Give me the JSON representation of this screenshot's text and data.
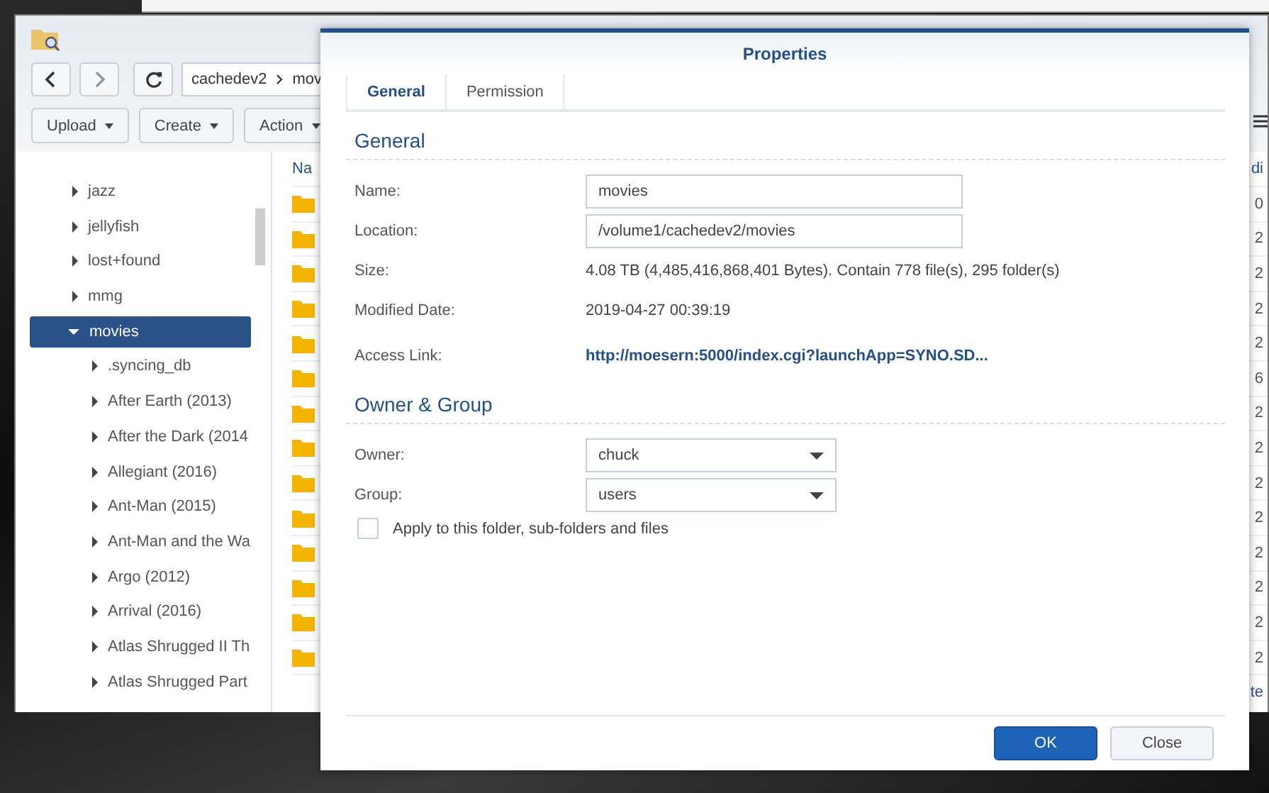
{
  "file_station": {
    "breadcrumb": [
      "cachedev2",
      "mov"
    ],
    "toolbar": [
      "Upload",
      "Create",
      "Action"
    ],
    "tree": [
      {
        "label": "jazz",
        "expanded": false,
        "selected": false
      },
      {
        "label": "jellyfish",
        "expanded": false,
        "selected": false
      },
      {
        "label": "lost+found",
        "expanded": false,
        "selected": false
      },
      {
        "label": "mmg",
        "expanded": false,
        "selected": false
      },
      {
        "label": "movies",
        "expanded": true,
        "selected": true,
        "children": [
          {
            "label": ".syncing_db",
            "expanded": false,
            "selected": false
          },
          {
            "label": "After Earth (2013)",
            "expanded": false,
            "selected": false
          },
          {
            "label": "After the Dark (2014",
            "expanded": false,
            "selected": false
          },
          {
            "label": "Allegiant (2016)",
            "expanded": false,
            "selected": false
          },
          {
            "label": "Ant-Man (2015)",
            "expanded": false,
            "selected": false
          },
          {
            "label": "Ant-Man and the Wa",
            "expanded": false,
            "selected": false
          },
          {
            "label": "Argo (2012)",
            "expanded": false,
            "selected": false
          },
          {
            "label": "Arrival (2016)",
            "expanded": false,
            "selected": false
          },
          {
            "label": "Atlas Shrugged II Th",
            "expanded": false,
            "selected": false
          },
          {
            "label": "Atlas Shrugged Part",
            "expanded": false,
            "selected": false
          }
        ]
      }
    ],
    "file_list": {
      "column_1_header": "Na",
      "column_2_header": "di",
      "rows": [
        {
          "column_2": "0"
        },
        {
          "column_2": "2"
        },
        {
          "column_2": "2"
        },
        {
          "column_2": "2"
        },
        {
          "column_2": "2"
        },
        {
          "column_2": "6"
        },
        {
          "column_2": "2"
        },
        {
          "column_2": "2"
        },
        {
          "column_2": "2"
        },
        {
          "column_2": "2"
        },
        {
          "column_2": "2"
        },
        {
          "column_2": "2"
        },
        {
          "column_2": "2"
        },
        {
          "column_2": "2"
        }
      ],
      "footer": "te"
    }
  },
  "dialog": {
    "title": "Properties",
    "tabs": [
      {
        "label": "General",
        "selected": true
      },
      {
        "label": "Permission",
        "selected": false
      }
    ],
    "sections": [
      {
        "title": "General",
        "fields": [
          {
            "label": "Name:",
            "kind": "input",
            "value": "movies"
          },
          {
            "label": "Location:",
            "kind": "input",
            "value": "/volume1/cachedev2/movies"
          },
          {
            "label": "Size:",
            "kind": "text",
            "value": "4.08 TB (4,485,416,868,401 Bytes). Contain 778 file(s), 295 folder(s)"
          },
          {
            "label": "Modified Date:",
            "kind": "text",
            "value": "2019-04-27 00:39:19"
          },
          {
            "label": "Access Link:",
            "kind": "link",
            "value": "http://moesern:5000/index.cgi?launchApp=SYNO.SD..."
          }
        ]
      },
      {
        "title": "Owner & Group",
        "fields": [
          {
            "label": "Owner:",
            "kind": "select",
            "value": "chuck"
          },
          {
            "label": "Group:",
            "kind": "select",
            "value": "users"
          }
        ]
      }
    ],
    "apply_checkbox": {
      "label": "Apply to this folder, sub-folders and files",
      "checked": false
    },
    "buttons": [
      {
        "label": "OK",
        "kind": "primary"
      },
      {
        "label": "Close",
        "kind": "secondary"
      }
    ]
  }
}
